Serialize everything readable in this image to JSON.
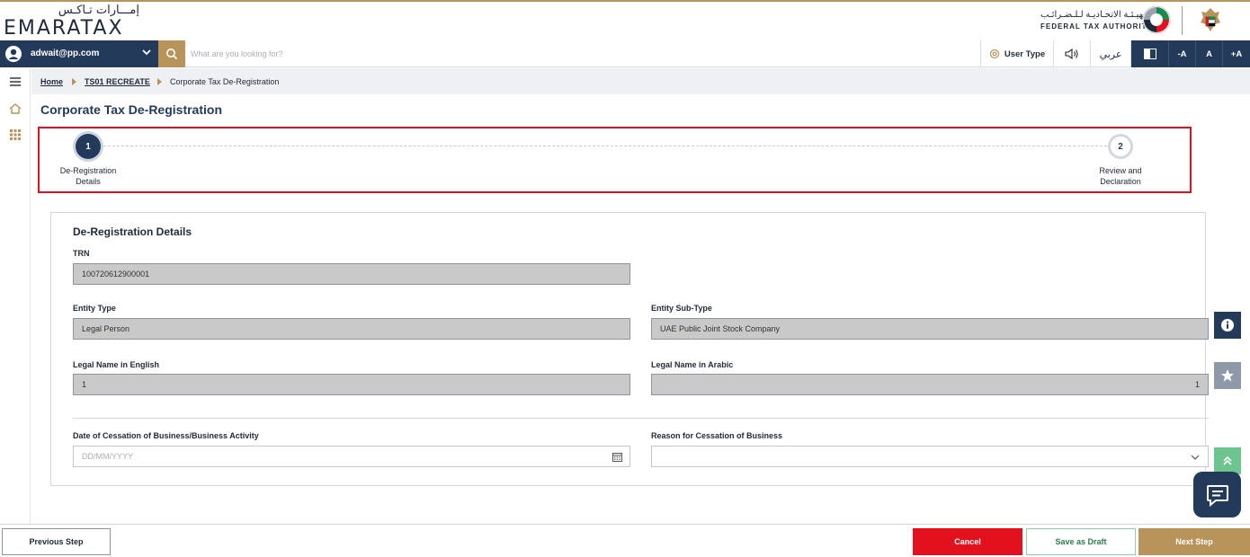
{
  "header": {
    "logo_ar": "إمـــارات تـاكـس",
    "logo_en": "EMARATAX",
    "authority_ar": "الـهيـئـة الاتحـاديـة لـلـضـرائـب",
    "authority_en": "FEDERAL TAX AUTHORITY"
  },
  "toolbar": {
    "user_email": "adwait@pp.com",
    "search_placeholder": "What are you looking for?",
    "user_type_label": "User Type",
    "language_label": "عربي",
    "font_decrease": "-A",
    "font_normal": "A",
    "font_increase": "+A"
  },
  "breadcrumb": {
    "home": "Home",
    "section": "TS01 RECREATE",
    "current": "Corporate Tax De-Registration"
  },
  "page": {
    "title": "Corporate Tax De-Registration"
  },
  "stepper": {
    "steps": [
      {
        "number": "1",
        "label_line1": "De-Registration",
        "label_line2": "Details",
        "active": true
      },
      {
        "number": "2",
        "label_line1": "Review and",
        "label_line2": "Declaration",
        "active": false
      }
    ]
  },
  "form": {
    "section_title": "De-Registration Details",
    "trn": {
      "label": "TRN",
      "value": "100720612900001"
    },
    "entity_type": {
      "label": "Entity Type",
      "value": "Legal Person"
    },
    "entity_sub_type": {
      "label": "Entity Sub-Type",
      "value": "UAE Public Joint Stock Company"
    },
    "legal_name_en": {
      "label": "Legal Name in English",
      "value": "1"
    },
    "legal_name_ar": {
      "label": "Legal Name in Arabic",
      "value": "1"
    },
    "cessation_date": {
      "label": "Date of Cessation of Business/Business Activity",
      "placeholder": "DD/MM/YYYY"
    },
    "cessation_reason": {
      "label": "Reason for Cessation of Business",
      "value": ""
    }
  },
  "footer": {
    "previous": "Previous Step",
    "cancel": "Cancel",
    "save_draft": "Save as Draft",
    "next": "Next Step"
  },
  "colors": {
    "navy": "#233a5b",
    "gold": "#b8935a",
    "red": "#e3101e",
    "green": "#6dc48f"
  }
}
